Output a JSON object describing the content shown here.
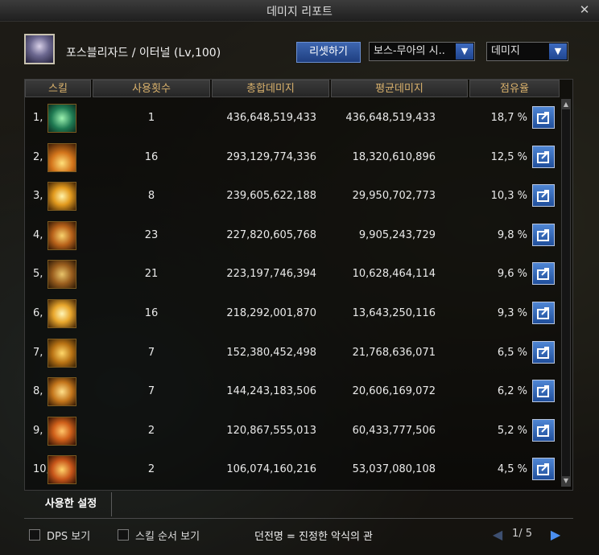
{
  "window": {
    "title": "데미지 리포트",
    "close_glyph": "✕"
  },
  "character": {
    "name_line": "포스블리자드 / 이터널 (Lv,100)"
  },
  "controls": {
    "reset_label": "리셋하기",
    "boss_select_value": "보스-무아의 시..",
    "metric_select_value": "데미지",
    "arrow_glyph": "▼"
  },
  "table": {
    "headers": [
      "스킬",
      "사용횟수",
      "총합데미지",
      "평균데미지",
      "점유율"
    ],
    "rows": [
      {
        "rank": "1,",
        "icon": "skill-icon-green-burst",
        "count": "1",
        "total": "436,648,519,433",
        "avg": "436,648,519,433",
        "share": "18,7 %"
      },
      {
        "rank": "2,",
        "icon": "skill-icon-flame-burst",
        "count": "16",
        "total": "293,129,774,336",
        "avg": "18,320,610,896",
        "share": "12,5 %"
      },
      {
        "rank": "3,",
        "icon": "skill-icon-star-burst",
        "count": "8",
        "total": "239,605,622,188",
        "avg": "29,950,702,773",
        "share": "10,3 %"
      },
      {
        "rank": "4,",
        "icon": "skill-icon-arrow-spread",
        "count": "23",
        "total": "227,820,605,768",
        "avg": "9,905,243,729",
        "share": "9,8 %"
      },
      {
        "rank": "5,",
        "icon": "skill-icon-bow",
        "count": "21",
        "total": "223,197,746,394",
        "avg": "10,628,464,114",
        "share": "9,6 %"
      },
      {
        "rank": "6,",
        "icon": "skill-icon-star-flash",
        "count": "16",
        "total": "218,292,001,870",
        "avg": "13,643,250,116",
        "share": "9,3 %"
      },
      {
        "rank": "7,",
        "icon": "skill-icon-crown-eye",
        "count": "7",
        "total": "152,380,452,498",
        "avg": "21,768,636,071",
        "share": "6,5 %"
      },
      {
        "rank": "8,",
        "icon": "skill-icon-wing-strike",
        "count": "7",
        "total": "144,243,183,506",
        "avg": "20,606,169,072",
        "share": "6,2 %"
      },
      {
        "rank": "9,",
        "icon": "skill-icon-fire-ring",
        "count": "2",
        "total": "120,867,555,013",
        "avg": "60,433,777,506",
        "share": "5,2 %"
      },
      {
        "rank": "10,",
        "icon": "skill-icon-fire-slash",
        "count": "2",
        "total": "106,074,160,216",
        "avg": "53,037,080,108",
        "share": "4,5 %"
      }
    ]
  },
  "tabs": {
    "used_settings": "사용한 설정"
  },
  "footer": {
    "dps_view": "DPS 보기",
    "skill_order_view": "스킬 순서 보기",
    "dungeon": "던전명 = 진정한 악식의 관",
    "page": "1/ 5"
  },
  "colors": {
    "header_text": "#d9b16c",
    "accent_blue": "#2f62b8"
  }
}
